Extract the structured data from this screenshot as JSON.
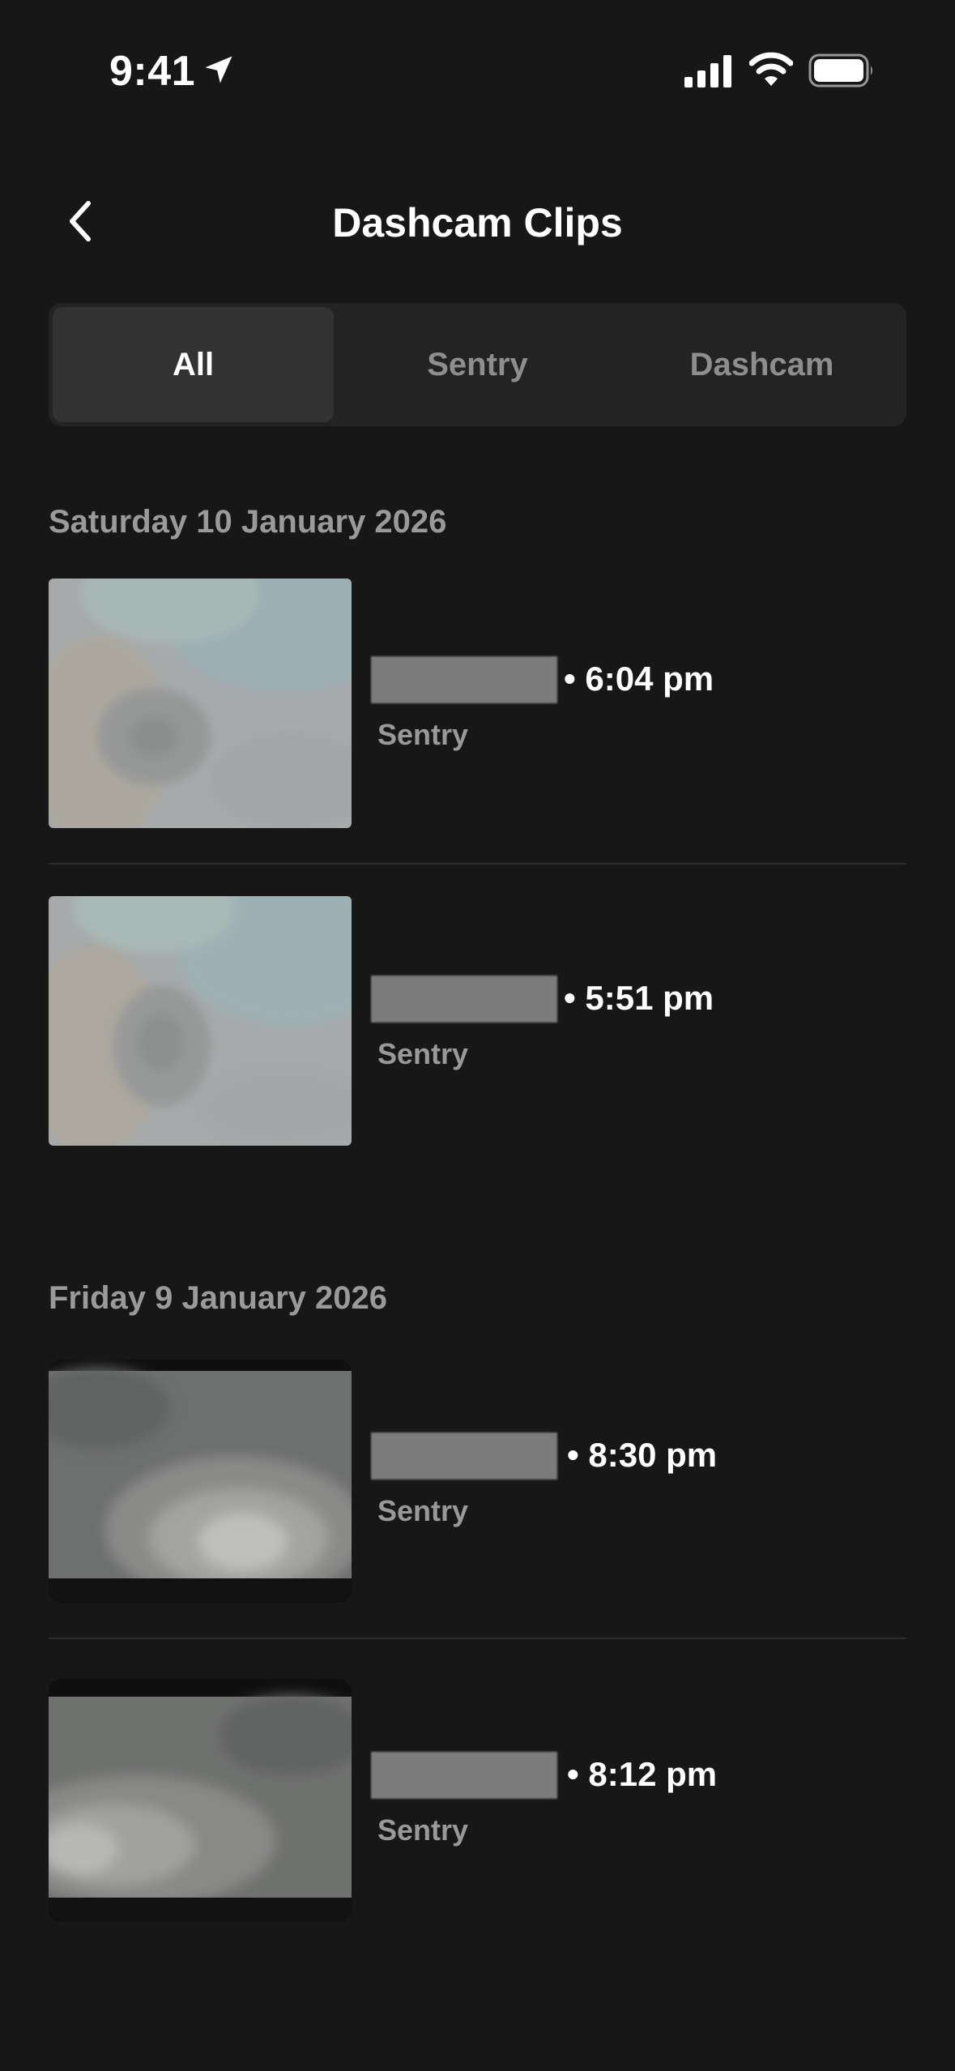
{
  "status_bar": {
    "time": "9:41"
  },
  "header": {
    "title": "Dashcam Clips"
  },
  "tabs": [
    {
      "label": "All",
      "active": true
    },
    {
      "label": "Sentry",
      "active": false
    },
    {
      "label": "Dashcam",
      "active": false
    }
  ],
  "sections": [
    {
      "date": "Saturday 10 January 2026",
      "clips": [
        {
          "time": "• 6:04 pm",
          "type": "Sentry"
        },
        {
          "time": "• 5:51 pm",
          "type": "Sentry"
        }
      ]
    },
    {
      "date": "Friday 9 January 2026",
      "clips": [
        {
          "time": "• 8:30 pm",
          "type": "Sentry"
        },
        {
          "time": "• 8:12 pm",
          "type": "Sentry"
        }
      ]
    }
  ],
  "colors": {
    "background": "#171717",
    "segment_bg": "#232323",
    "segment_active": "#323232",
    "muted_text": "#9a9a9a"
  }
}
